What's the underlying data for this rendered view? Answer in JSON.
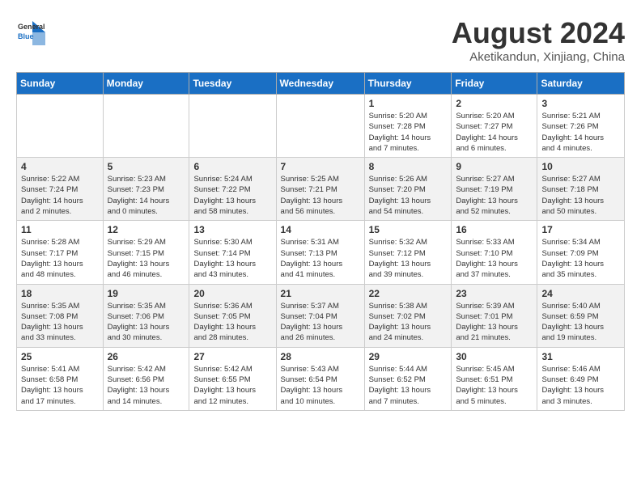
{
  "logo": {
    "line1": "General",
    "line2": "Blue"
  },
  "title": "August 2024",
  "subtitle": "Aketikandun, Xinjiang, China",
  "days_of_week": [
    "Sunday",
    "Monday",
    "Tuesday",
    "Wednesday",
    "Thursday",
    "Friday",
    "Saturday"
  ],
  "weeks": [
    [
      {
        "day": "",
        "info": ""
      },
      {
        "day": "",
        "info": ""
      },
      {
        "day": "",
        "info": ""
      },
      {
        "day": "",
        "info": ""
      },
      {
        "day": "1",
        "info": "Sunrise: 5:20 AM\nSunset: 7:28 PM\nDaylight: 14 hours\nand 7 minutes."
      },
      {
        "day": "2",
        "info": "Sunrise: 5:20 AM\nSunset: 7:27 PM\nDaylight: 14 hours\nand 6 minutes."
      },
      {
        "day": "3",
        "info": "Sunrise: 5:21 AM\nSunset: 7:26 PM\nDaylight: 14 hours\nand 4 minutes."
      }
    ],
    [
      {
        "day": "4",
        "info": "Sunrise: 5:22 AM\nSunset: 7:24 PM\nDaylight: 14 hours\nand 2 minutes."
      },
      {
        "day": "5",
        "info": "Sunrise: 5:23 AM\nSunset: 7:23 PM\nDaylight: 14 hours\nand 0 minutes."
      },
      {
        "day": "6",
        "info": "Sunrise: 5:24 AM\nSunset: 7:22 PM\nDaylight: 13 hours\nand 58 minutes."
      },
      {
        "day": "7",
        "info": "Sunrise: 5:25 AM\nSunset: 7:21 PM\nDaylight: 13 hours\nand 56 minutes."
      },
      {
        "day": "8",
        "info": "Sunrise: 5:26 AM\nSunset: 7:20 PM\nDaylight: 13 hours\nand 54 minutes."
      },
      {
        "day": "9",
        "info": "Sunrise: 5:27 AM\nSunset: 7:19 PM\nDaylight: 13 hours\nand 52 minutes."
      },
      {
        "day": "10",
        "info": "Sunrise: 5:27 AM\nSunset: 7:18 PM\nDaylight: 13 hours\nand 50 minutes."
      }
    ],
    [
      {
        "day": "11",
        "info": "Sunrise: 5:28 AM\nSunset: 7:17 PM\nDaylight: 13 hours\nand 48 minutes."
      },
      {
        "day": "12",
        "info": "Sunrise: 5:29 AM\nSunset: 7:15 PM\nDaylight: 13 hours\nand 46 minutes."
      },
      {
        "day": "13",
        "info": "Sunrise: 5:30 AM\nSunset: 7:14 PM\nDaylight: 13 hours\nand 43 minutes."
      },
      {
        "day": "14",
        "info": "Sunrise: 5:31 AM\nSunset: 7:13 PM\nDaylight: 13 hours\nand 41 minutes."
      },
      {
        "day": "15",
        "info": "Sunrise: 5:32 AM\nSunset: 7:12 PM\nDaylight: 13 hours\nand 39 minutes."
      },
      {
        "day": "16",
        "info": "Sunrise: 5:33 AM\nSunset: 7:10 PM\nDaylight: 13 hours\nand 37 minutes."
      },
      {
        "day": "17",
        "info": "Sunrise: 5:34 AM\nSunset: 7:09 PM\nDaylight: 13 hours\nand 35 minutes."
      }
    ],
    [
      {
        "day": "18",
        "info": "Sunrise: 5:35 AM\nSunset: 7:08 PM\nDaylight: 13 hours\nand 33 minutes."
      },
      {
        "day": "19",
        "info": "Sunrise: 5:35 AM\nSunset: 7:06 PM\nDaylight: 13 hours\nand 30 minutes."
      },
      {
        "day": "20",
        "info": "Sunrise: 5:36 AM\nSunset: 7:05 PM\nDaylight: 13 hours\nand 28 minutes."
      },
      {
        "day": "21",
        "info": "Sunrise: 5:37 AM\nSunset: 7:04 PM\nDaylight: 13 hours\nand 26 minutes."
      },
      {
        "day": "22",
        "info": "Sunrise: 5:38 AM\nSunset: 7:02 PM\nDaylight: 13 hours\nand 24 minutes."
      },
      {
        "day": "23",
        "info": "Sunrise: 5:39 AM\nSunset: 7:01 PM\nDaylight: 13 hours\nand 21 minutes."
      },
      {
        "day": "24",
        "info": "Sunrise: 5:40 AM\nSunset: 6:59 PM\nDaylight: 13 hours\nand 19 minutes."
      }
    ],
    [
      {
        "day": "25",
        "info": "Sunrise: 5:41 AM\nSunset: 6:58 PM\nDaylight: 13 hours\nand 17 minutes."
      },
      {
        "day": "26",
        "info": "Sunrise: 5:42 AM\nSunset: 6:56 PM\nDaylight: 13 hours\nand 14 minutes."
      },
      {
        "day": "27",
        "info": "Sunrise: 5:42 AM\nSunset: 6:55 PM\nDaylight: 13 hours\nand 12 minutes."
      },
      {
        "day": "28",
        "info": "Sunrise: 5:43 AM\nSunset: 6:54 PM\nDaylight: 13 hours\nand 10 minutes."
      },
      {
        "day": "29",
        "info": "Sunrise: 5:44 AM\nSunset: 6:52 PM\nDaylight: 13 hours\nand 7 minutes."
      },
      {
        "day": "30",
        "info": "Sunrise: 5:45 AM\nSunset: 6:51 PM\nDaylight: 13 hours\nand 5 minutes."
      },
      {
        "day": "31",
        "info": "Sunrise: 5:46 AM\nSunset: 6:49 PM\nDaylight: 13 hours\nand 3 minutes."
      }
    ]
  ]
}
